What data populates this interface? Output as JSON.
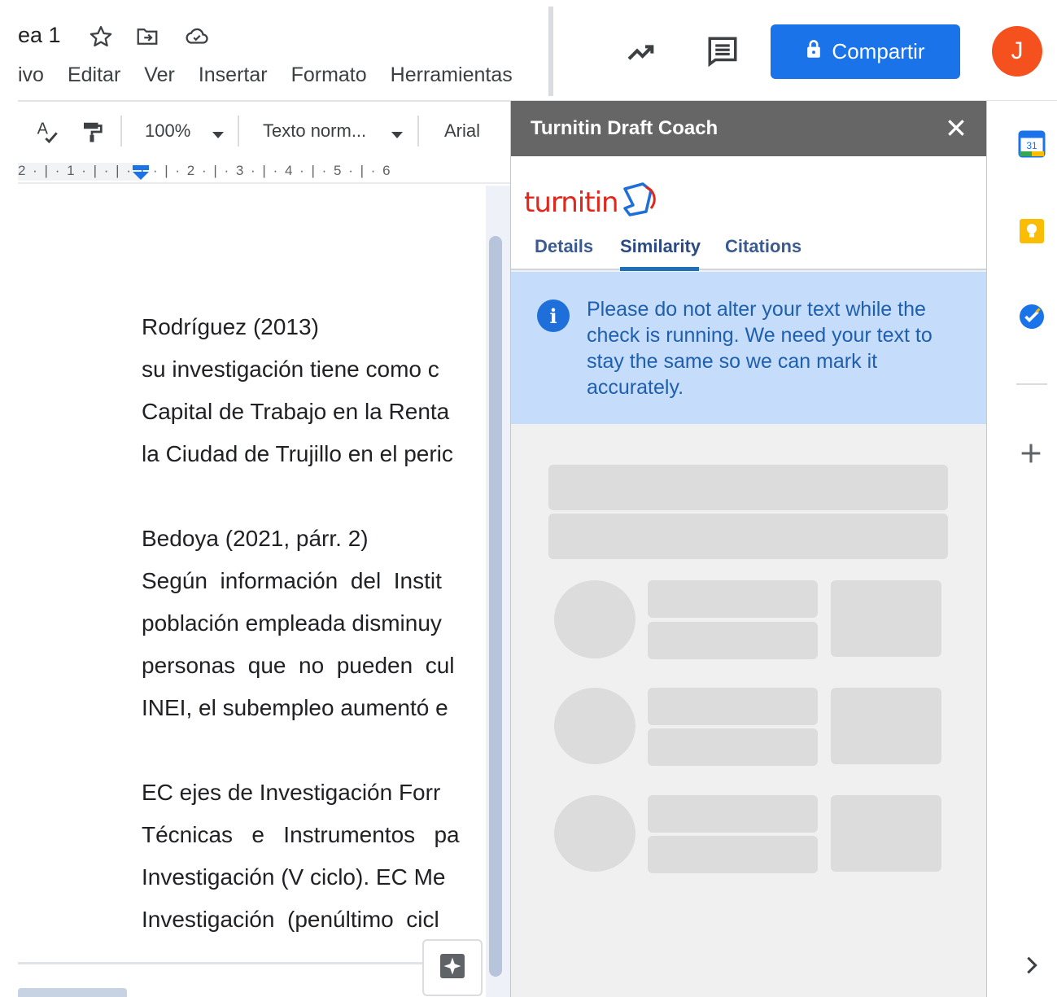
{
  "header": {
    "title": "ea 1",
    "menu": [
      "ivo",
      "Editar",
      "Ver",
      "Insertar",
      "Formato",
      "Herramientas"
    ],
    "share_label": "Compartir",
    "avatar_initial": "J",
    "share_color": "#1a73e8",
    "avatar_color": "#f4511e",
    "icons": [
      "star-icon",
      "move-to-folder-icon",
      "cloud-saved-icon",
      "trending-icon",
      "comment-icon",
      "lock-icon"
    ]
  },
  "toolbar": {
    "zoom": "100%",
    "style": "Texto norm...",
    "font": "Arial",
    "icons": [
      "spellcheck-icon",
      "paint-format-icon",
      "dropdown-arrow-icon"
    ]
  },
  "ruler": {
    "marks": "2 · | · 1 · |   · | · 1 · | · 2 · | · 3 · | · 4 · | · 5 · | · 6"
  },
  "document": {
    "paragraphs": [
      {
        "lines": [
          "Rodríguez (2013)",
          "su investigación tiene como c",
          "Capital de Trabajo en la Renta",
          "la Ciudad de Trujillo en el peric"
        ]
      },
      {
        "lines": [
          "Bedoya (2021, párr. 2)",
          "Según  información  del  Instit",
          "población empleada disminuy",
          "personas  que  no  pueden  cul",
          "INEI, el subempleo aumentó e"
        ]
      },
      {
        "lines": [
          "EC ejes de Investigación Forr",
          "Técnicas   e   Instrumentos   pa",
          "Investigación (V ciclo). EC Me",
          "Investigación  (penúltimo  cicl"
        ]
      }
    ]
  },
  "turnitin": {
    "panel_title": "Turnitin Draft Coach",
    "logo_text": "turnitin",
    "tabs": [
      "Details",
      "Similarity",
      "Citations"
    ],
    "active_tab": "Similarity",
    "notice": "Please do not alter your text while the check is running. We need your text to stay the same so we can mark it accurately.",
    "header_color": "#666666",
    "notice_color": "#c5dcfb",
    "logo_color": "#e1261c"
  },
  "side_rail": {
    "icons": [
      "calendar-icon",
      "keep-icon",
      "tasks-icon",
      "add-icon",
      "expand-chevron-icon"
    ],
    "calendar_day": "31"
  }
}
